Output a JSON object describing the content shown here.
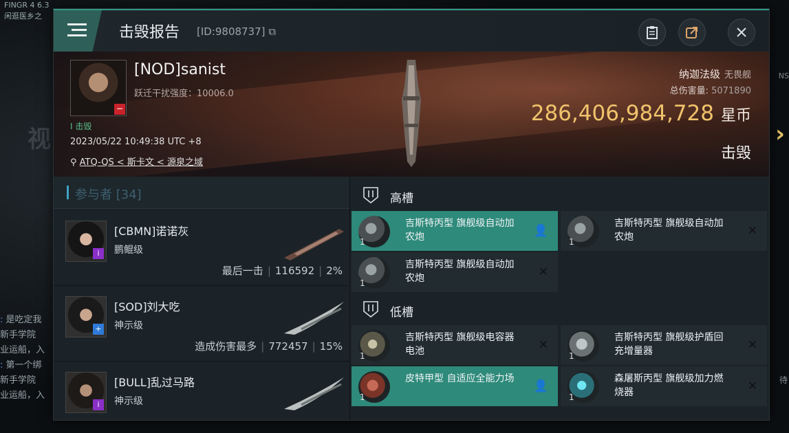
{
  "background": {
    "top_left_lines": [
      "FINGR 4 6.3",
      "闲逛医乡之"
    ],
    "chat_lines": [
      "是吃定我",
      "新手学院",
      "业运船，入",
      "第一个绑",
      "新手学院",
      "业运船，入"
    ]
  },
  "header": {
    "title": "击毁报告",
    "id_text": "[ID:9808737]"
  },
  "victim": {
    "name": "[NOD]sanist",
    "warp_disrupt": "跃迁干扰强度：10006.0",
    "kill_tag": "I 击毁",
    "time": "2023/05/22 10:49:38 UTC +8",
    "location": "ATQ-QS < 斯卡文 < 源泉之域",
    "ship_class": "纳迦法级",
    "ship_sub": "无畏舰",
    "total_damage_label": "总伤害量: ",
    "total_damage_value": "5071890",
    "isk_value": "286,406,984,728",
    "isk_unit": "星币",
    "result": "击毁"
  },
  "participants": {
    "label": "参与者 [34]",
    "rows": [
      {
        "name": "[CBMN]诺诺灰",
        "ship": "鹏鲲级",
        "tag": "最后一击",
        "damage": "116592",
        "percent": "2%",
        "badge_color": "#8a2fc8",
        "badge": "i"
      },
      {
        "name": "[SOD]刘大吃",
        "ship": "神示级",
        "tag": "造成伤害最多",
        "damage": "772457",
        "percent": "15%",
        "badge_color": "#2f7ad8",
        "badge": "+"
      },
      {
        "name": "[BULL]乱过马路",
        "ship": "神示级",
        "tag": "",
        "damage": "",
        "percent": "",
        "badge_color": "#8a2fc8",
        "badge": "i"
      }
    ]
  },
  "fitting": {
    "high_label": "高槽",
    "low_label": "低槽",
    "high": [
      {
        "name": "吉斯特丙型 旗舰级自动加农炮",
        "qty": "1",
        "highlight": true,
        "action": "person"
      },
      {
        "name": "吉斯特丙型 旗舰级自动加农炮",
        "qty": "1",
        "highlight": false,
        "action": "x"
      },
      {
        "name": "吉斯特丙型 旗舰级自动加农炮",
        "qty": "1",
        "highlight": false,
        "action": "x"
      }
    ],
    "low": [
      {
        "name": "吉斯特丙型 旗舰级电容器电池",
        "qty": "1",
        "highlight": false,
        "action": "x"
      },
      {
        "name": "吉斯特丙型 旗舰级护盾回充增量器",
        "qty": "1",
        "highlight": false,
        "action": "x"
      },
      {
        "name": "皮特甲型 自适应全能力场",
        "qty": "1",
        "highlight": true,
        "action": "person"
      },
      {
        "name": "森屠斯丙型 旗舰级加力燃烧器",
        "qty": "1",
        "highlight": false,
        "action": "x"
      }
    ]
  },
  "colors": {
    "accent": "#2f9a84",
    "isk": "#f0c36c",
    "slot_highlight": "#2e8a7a"
  }
}
